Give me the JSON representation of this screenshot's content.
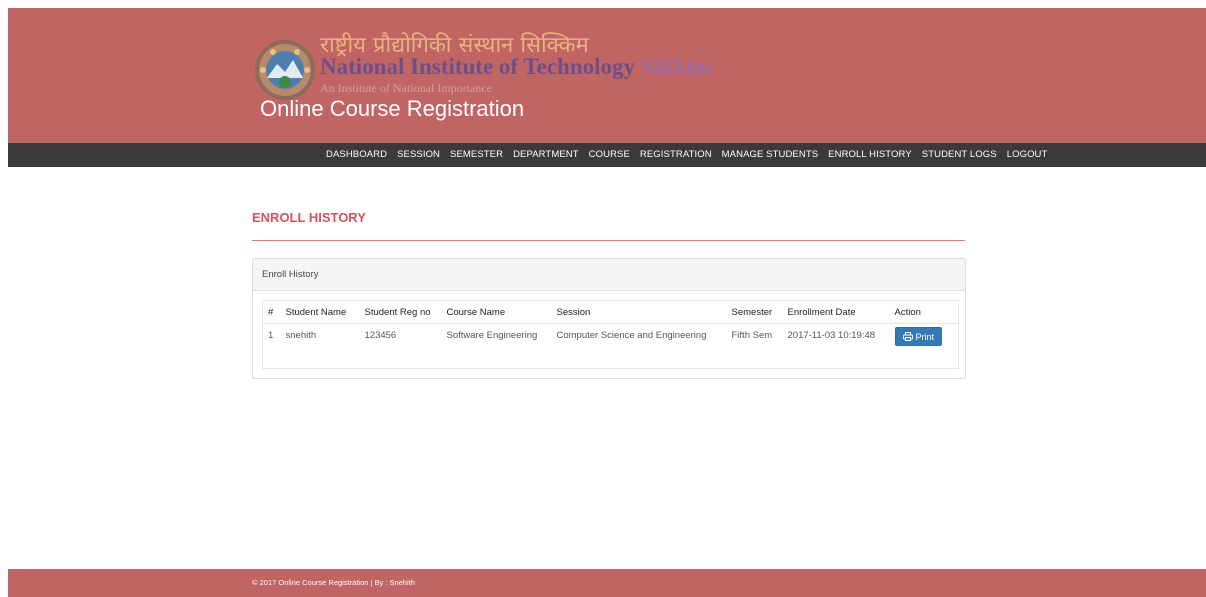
{
  "header": {
    "hindi_name": "राष्ट्रीय प्रौद्योगिकी संस्थान सिक्किम",
    "institute_name": "National Institute of Technology",
    "institute_city": "Sikkim",
    "tagline": "An Institute of National Importance",
    "app_title": "Online Course Registration",
    "colors": {
      "header_bg": "#c06464",
      "nav_bg": "#3a3a3a"
    }
  },
  "nav": {
    "items": [
      "DASHBOARD",
      "SESSION",
      "SEMESTER",
      "DEPARTMENT",
      "COURSE",
      "REGISTRATION",
      "MANAGE STUDENTS",
      "ENROLL HISTORY",
      "STUDENT LOGS",
      "LOGOUT"
    ]
  },
  "main": {
    "page_heading": "ENROLL HISTORY",
    "panel_title": "Enroll History",
    "table": {
      "columns": [
        "#",
        "Student Name",
        "Student Reg no",
        "Course Name",
        "Session",
        "Semester",
        "Enrollment Date",
        "Action"
      ],
      "rows": [
        {
          "index": "1",
          "student_name": "snehith",
          "reg_no": "123456",
          "course_name": "Software Engineering",
          "session": "Computer Science and Engineering",
          "semester": "Fifth Sem",
          "enrollment_date": "2017-11-03 10:19:48",
          "action_label": "Print",
          "action_icon": "print-icon"
        }
      ]
    }
  },
  "footer": {
    "text": "© 2017 Online Course Registration | By : Snehith"
  }
}
